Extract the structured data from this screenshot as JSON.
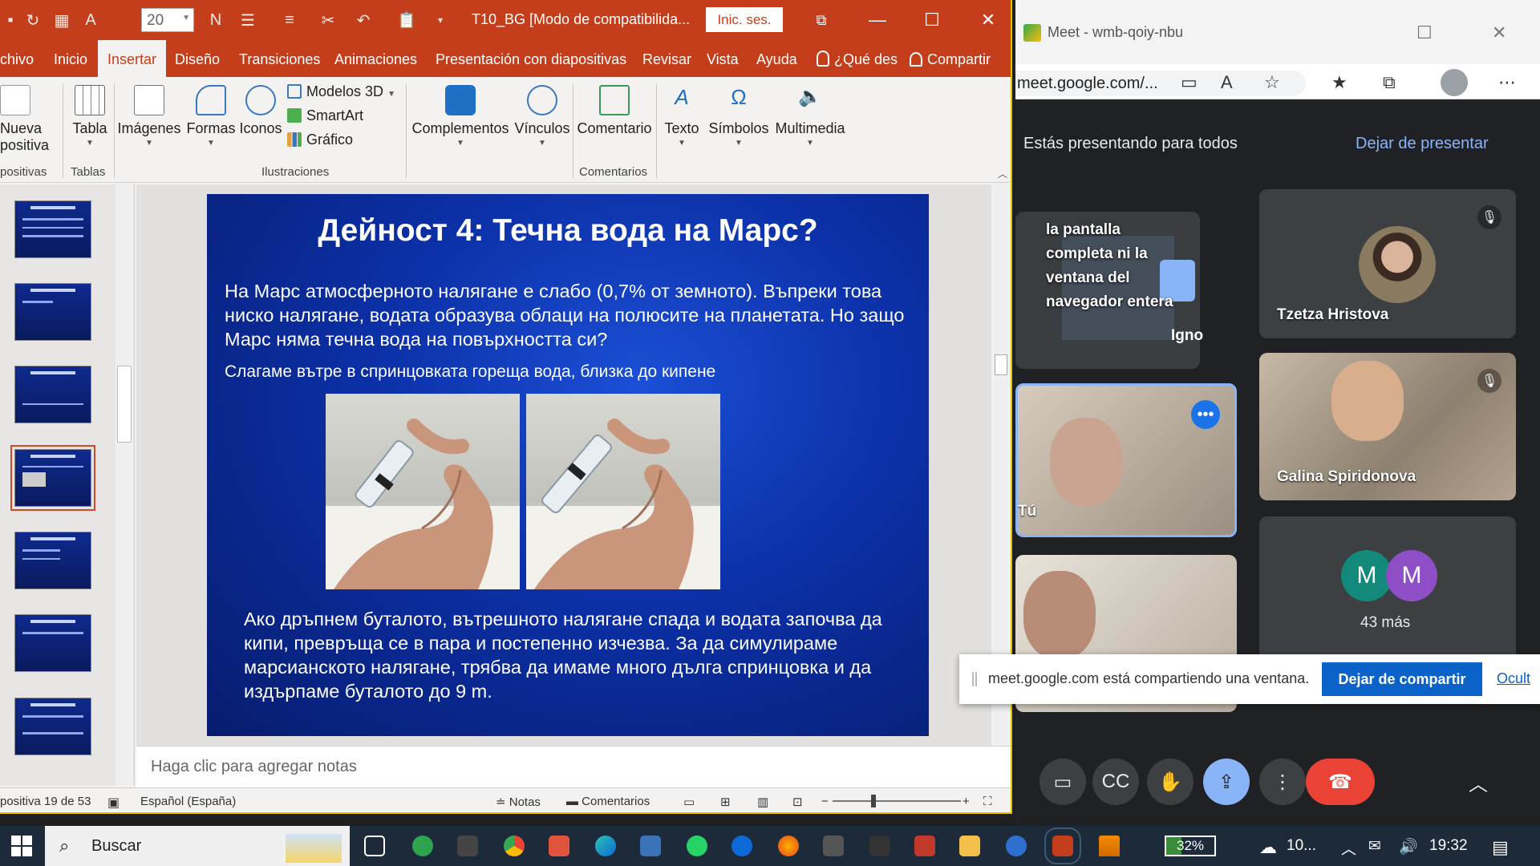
{
  "powerpoint": {
    "quick_access": {
      "font_size": "20"
    },
    "doc_title": "T10_BG [Modo de compatibilida...",
    "sign_in": "Inic. ses.",
    "tabs": [
      "chivo",
      "Inicio",
      "Insertar",
      "Diseño",
      "Transiciones",
      "Animaciones",
      "Presentación con diapositivas",
      "Revisar",
      "Vista",
      "Ayuda",
      "¿Qué des",
      "Compartir"
    ],
    "ribbon": {
      "new_slide": [
        "Nueva",
        "positiva"
      ],
      "tables": "Tabla",
      "images": "Imágenes",
      "shapes": "Formas",
      "icons": "Iconos",
      "models3d": "Modelos 3D",
      "smartart": "SmartArt",
      "chart": "Gráfico",
      "addins": "Complementos",
      "links": "Vínculos",
      "comment": "Comentario",
      "text": "Texto",
      "symbols": "Símbolos",
      "media": "Multimedia",
      "groups": {
        "slides": "positivas",
        "tables": "Tablas",
        "illustrations": "Ilustraciones",
        "comments": "Comentarios"
      }
    },
    "slide": {
      "title": "Дейност 4: Течна вода на Марс?",
      "p1": "На Марс атмосферното налягане е слабо (0,7% от земното). Въпреки това ниско налягане, водата образува облаци на полюсите на планетата. Но защо Марс няма течна вода на повърхността си?",
      "p2": "Слагаме вътре в спринцовката гореща вода, близка до кипене",
      "p3": "Ако дръпнем буталото, вътрешното налягане спада и водата започва да кипи, превръща се в пара и постепенно изчезва. За да симулираме марсианското налягане, трябва да имаме много дълга спринцовка и да издърпаме буталото до 9 m."
    },
    "notes_placeholder": "Haga clic para agregar notas",
    "status": {
      "slide_num": "positiva 19 de 53",
      "language": "Español (España)",
      "notes": "Notas",
      "comments": "Comentarios"
    }
  },
  "meet": {
    "window_title": "Meet - wmb-qoiy-nbu",
    "url": "meet.google.com/...",
    "presenting_text": "Estás presentando para todos",
    "stop_presenting": "Dejar de presentar",
    "screen_tile_text": "la pantalla completa ni la ventana del navegador entera",
    "ignore": "Igno",
    "participants": {
      "p1": "Tzetza Hristova",
      "p2": "Galina Spiridonova",
      "self": "Tú",
      "more": "43 más",
      "avatar_letters": [
        "M",
        "M"
      ]
    },
    "share_banner": {
      "text": "meet.google.com está compartiendo una ventana.",
      "stop": "Dejar de compartir",
      "hide": "Ocult"
    }
  },
  "taskbar": {
    "search": "Buscar",
    "battery": "32%",
    "weather": "10...",
    "time": "19:32"
  },
  "colors": {
    "ppt_accent": "#c43e1c",
    "slide_blue": "#0b2fa5",
    "meet_bg": "#202124",
    "share_blue": "#0b62c8",
    "end_call_red": "#ea4335"
  }
}
